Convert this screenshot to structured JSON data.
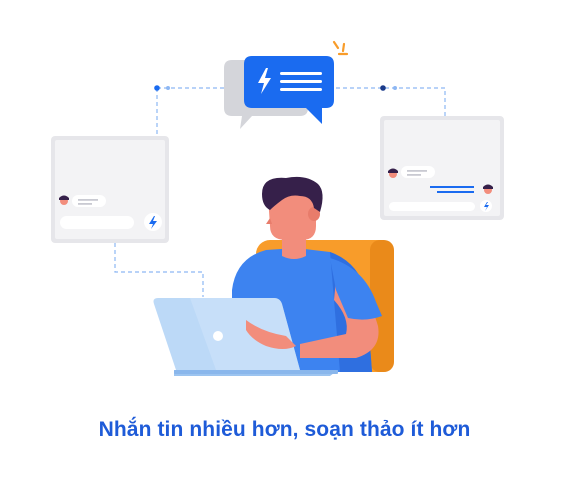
{
  "caption": "Nhắn tin nhiều hơn, soạn thảo ít hơn",
  "colors": {
    "accent_blue": "#1a6bf0",
    "caption_blue": "#1e5bd8",
    "panel_gray": "#e6e6ea",
    "chair_orange": "#f89c2a",
    "shirt_blue": "#3d83f0",
    "laptop_blue": "#bcd9f7",
    "hair": "#36204a",
    "skin": "#f28d7c"
  },
  "icons": [
    "lightning-icon",
    "chat-bubble-icon",
    "avatar-icon",
    "laptop-logo-icon"
  ]
}
